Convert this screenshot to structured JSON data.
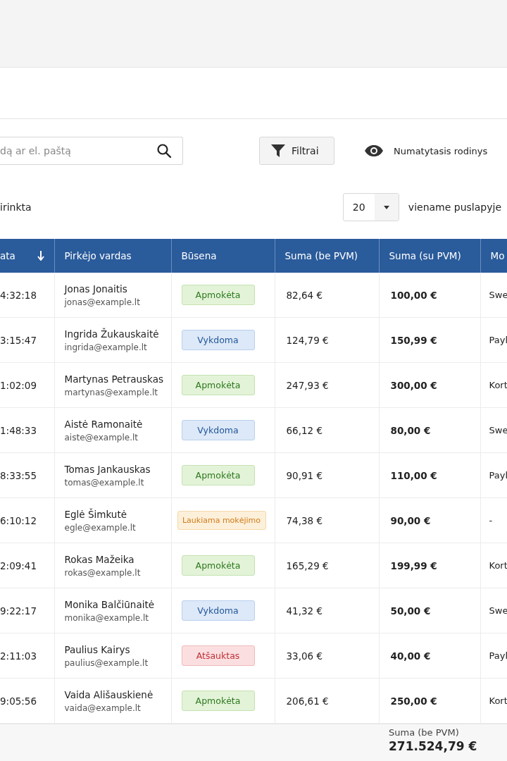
{
  "search": {
    "placeholder": "dą ar el. paštą"
  },
  "filter_button": "Filtrai",
  "view_button": "Numatytasis rodinys",
  "selection_text": "irinkta",
  "page_size": {
    "value": "20",
    "suffix": "viename puslapyje"
  },
  "table": {
    "columns": [
      {
        "label": "ata",
        "sorted": true
      },
      {
        "label": "Pirkėjo vardas"
      },
      {
        "label": "Būsena"
      },
      {
        "label": "Suma (be PVM)"
      },
      {
        "label": "Suma (su PVM)"
      },
      {
        "label": "Mo"
      }
    ],
    "rows": [
      {
        "time": "4:32:18",
        "name": "Jonas Jonaitis",
        "email": "jonas@example.lt",
        "status": {
          "label": "Apmokėta",
          "kind": "paid"
        },
        "net": "82,64 €",
        "gross": "100,00 €",
        "method": "Swe"
      },
      {
        "time": "3:15:47",
        "name": "Ingrida Žukauskaitė",
        "email": "ingrida@example.lt",
        "status": {
          "label": "Vykdoma",
          "kind": "progress"
        },
        "net": "124,79 €",
        "gross": "150,99 €",
        "method": "Payl"
      },
      {
        "time": "1:02:09",
        "name": "Martynas Petrauskas",
        "email": "martynas@example.lt",
        "status": {
          "label": "Apmokėta",
          "kind": "paid"
        },
        "net": "247,93 €",
        "gross": "300,00 €",
        "method": "Kort"
      },
      {
        "time": "1:48:33",
        "name": "Aistė Ramonaitė",
        "email": "aiste@example.lt",
        "status": {
          "label": "Vykdoma",
          "kind": "progress"
        },
        "net": "66,12 €",
        "gross": "80,00 €",
        "method": "Swe"
      },
      {
        "time": "8:33:55",
        "name": "Tomas Jankauskas",
        "email": "tomas@example.lt",
        "status": {
          "label": "Apmokėta",
          "kind": "paid"
        },
        "net": "90,91 €",
        "gross": "110,00 €",
        "method": "Payl"
      },
      {
        "time": "6:10:12",
        "name": "Eglė Šimkutė",
        "email": "egle@example.lt",
        "status": {
          "label": "Laukiama mokėjimo",
          "kind": "waiting"
        },
        "net": "74,38 €",
        "gross": "90,00 €",
        "method": "-"
      },
      {
        "time": "2:09:41",
        "name": "Rokas Mažeika",
        "email": "rokas@example.lt",
        "status": {
          "label": "Apmokėta",
          "kind": "paid"
        },
        "net": "165,29 €",
        "gross": "199,99 €",
        "method": "Kort"
      },
      {
        "time": "9:22:17",
        "name": "Monika Balčiūnaitė",
        "email": "monika@example.lt",
        "status": {
          "label": "Vykdoma",
          "kind": "progress"
        },
        "net": "41,32 €",
        "gross": "50,00 €",
        "method": "Swe"
      },
      {
        "time": "2:11:03",
        "name": "Paulius Kairys",
        "email": "paulius@example.lt",
        "status": {
          "label": "Atšauktas",
          "kind": "cancelled"
        },
        "net": "33,06 €",
        "gross": "40,00 €",
        "method": "Payl"
      },
      {
        "time": "9:05:56",
        "name": "Vaida Ališauskienė",
        "email": "vaida@example.lt",
        "status": {
          "label": "Apmokėta",
          "kind": "paid"
        },
        "net": "206,61 €",
        "gross": "250,00 €",
        "method": "Kort"
      }
    ]
  },
  "totals": [
    {
      "label": "Suma (be PVM)",
      "value": "271.524,79 €"
    }
  ]
}
